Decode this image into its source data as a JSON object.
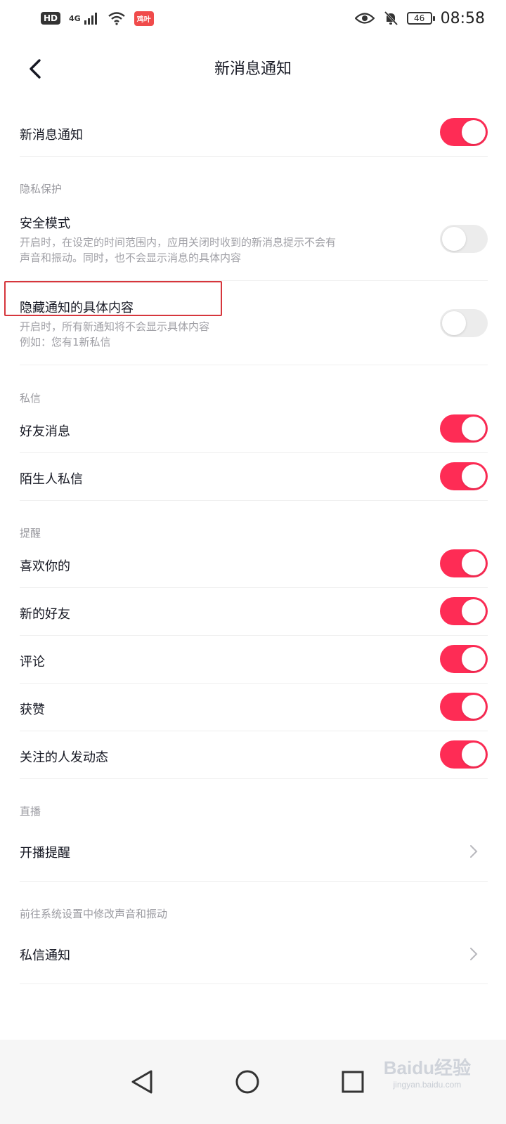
{
  "status_bar": {
    "hd": "HD",
    "network": "4G",
    "app_badge": "鸡叶",
    "battery": "46",
    "time": "08:58"
  },
  "header": {
    "title": "新消息通知"
  },
  "main_toggle": {
    "label": "新消息通知",
    "on": true
  },
  "privacy": {
    "header": "隐私保护",
    "safe_mode": {
      "label": "安全模式",
      "desc_line1": "开启时，在设定的时间范围内，应用关闭时收到的新消息提示不会有",
      "desc_line2": "声音和振动。同时，也不会显示消息的具体内容",
      "on": false
    },
    "hide_content": {
      "label": "隐藏通知的具体内容",
      "desc_line1": "开启时，所有新通知将不会显示具体内容",
      "desc_line2": "例如：您有1新私信",
      "on": false
    }
  },
  "dm": {
    "header": "私信",
    "friends": {
      "label": "好友消息",
      "on": true
    },
    "strangers": {
      "label": "陌生人私信",
      "on": true
    }
  },
  "reminders": {
    "header": "提醒",
    "likes_you": {
      "label": "喜欢你的",
      "on": true
    },
    "new_friends": {
      "label": "新的好友",
      "on": true
    },
    "comments": {
      "label": "评论",
      "on": true
    },
    "liked": {
      "label": "获赞",
      "on": true
    },
    "following_updates": {
      "label": "关注的人发动态",
      "on": true
    }
  },
  "live": {
    "header": "直播",
    "start_reminder": {
      "label": "开播提醒"
    }
  },
  "system": {
    "header": "前往系统设置中修改声音和振动",
    "dm_notification": {
      "label": "私信通知"
    }
  },
  "watermark": {
    "brand": "Baidu经验",
    "url": "jingyan.baidu.com"
  },
  "colors": {
    "accent": "#fe2c55",
    "toggle_off": "#ececec",
    "highlight": "#d6363c"
  }
}
